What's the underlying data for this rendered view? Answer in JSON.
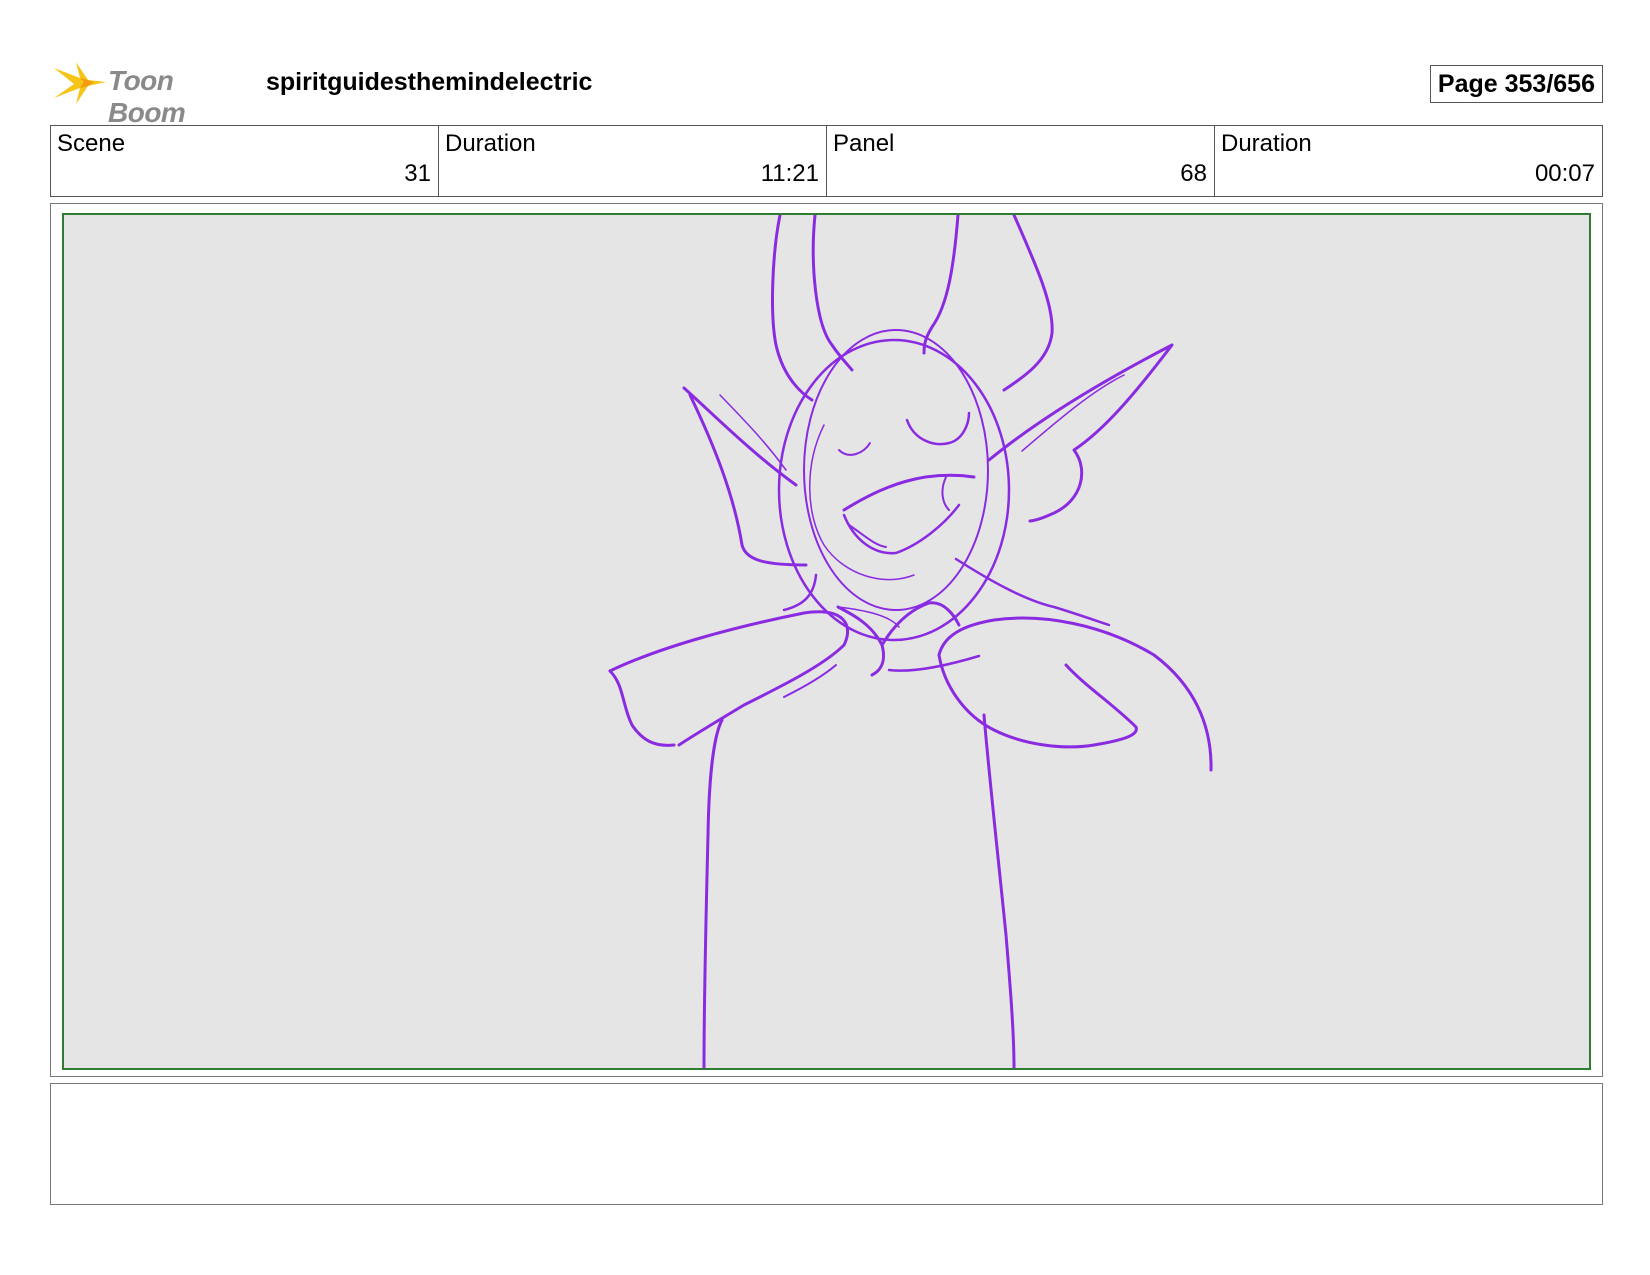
{
  "header": {
    "logo_text": "Toon Boom",
    "project_title": "spiritguidesthemindelectric",
    "page_label": "Page 353/656"
  },
  "info": {
    "scene_label": "Scene",
    "scene_value": "31",
    "scene_duration_label": "Duration",
    "scene_duration_value": "11:21",
    "panel_label": "Panel",
    "panel_value": "68",
    "panel_duration_label": "Duration",
    "panel_duration_value": "00:07"
  },
  "colors": {
    "sketch_stroke": "#8a2be2",
    "panel_border": "#2e7d32",
    "panel_bg": "#e5e5e5",
    "logo_star": "#f5c518"
  },
  "notes": {
    "text": ""
  }
}
